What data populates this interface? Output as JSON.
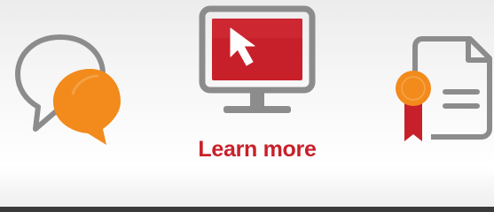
{
  "banner": {
    "cta_label": "Learn more",
    "colors": {
      "accent_red": "#c8202a",
      "accent_orange": "#f28a1c",
      "outline_gray": "#8c8c8c",
      "background": "#f4f4f4"
    },
    "icons": {
      "left": "chat-bubbles-icon",
      "center": "monitor-cursor-icon",
      "right": "certificate-ribbon-icon"
    }
  }
}
